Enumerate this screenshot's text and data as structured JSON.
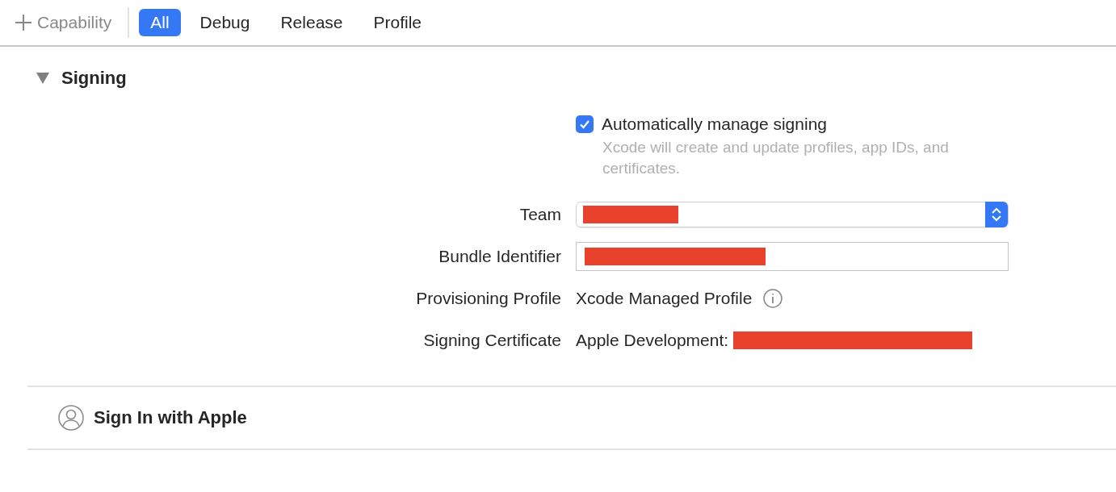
{
  "toolbar": {
    "add_button": {
      "label": "Capability"
    },
    "tabs": [
      {
        "label": "All",
        "selected": true
      },
      {
        "label": "Debug",
        "selected": false
      },
      {
        "label": "Release",
        "selected": false
      },
      {
        "label": "Profile",
        "selected": false
      }
    ]
  },
  "sections": [
    {
      "title": "Signing",
      "expanded": true,
      "auto_signing": {
        "label": "Automatically manage signing",
        "checked": true,
        "hint": "Xcode will create and update profiles, app IDs, and certificates."
      },
      "rows": [
        {
          "kind": "popup",
          "label": "Team"
        },
        {
          "kind": "field",
          "label": "Bundle Identifier"
        },
        {
          "kind": "info",
          "label": "Provisioning Profile",
          "value": "Xcode Managed Profile"
        },
        {
          "kind": "text",
          "label": "Signing Certificate",
          "value": "Apple Development:"
        }
      ]
    },
    {
      "title": "Sign In with Apple",
      "kind": "capability"
    }
  ]
}
